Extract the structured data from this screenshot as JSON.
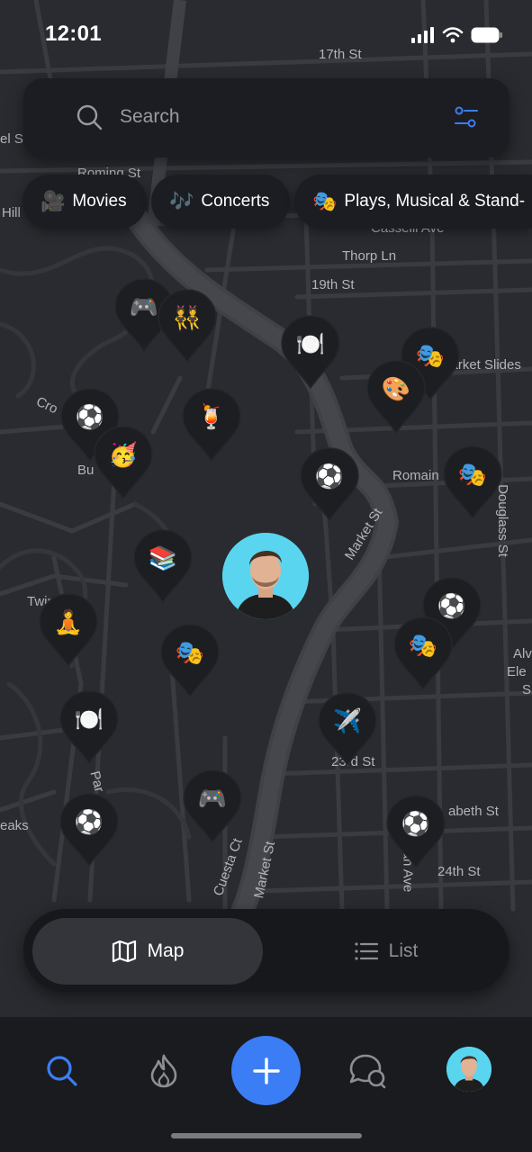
{
  "status": {
    "time": "12:01"
  },
  "search": {
    "placeholder": "Search"
  },
  "categories": [
    {
      "emoji": "🎥",
      "label": "Movies"
    },
    {
      "emoji": "🎶",
      "label": "Concerts"
    },
    {
      "emoji": "🎭",
      "label": "Plays, Musical & Stand-"
    }
  ],
  "map": {
    "streets": [
      "17th St",
      "Roming St",
      "Casselli Ave",
      "Thorp Ln",
      "19th St",
      "Market Slides",
      "Romain",
      "Market St",
      "23rd St",
      "Market St",
      "Cuesta Ct",
      "24th St",
      "abeth St",
      "Douglass St"
    ],
    "edge_labels": [
      "el St",
      "Hill",
      "Cro",
      "Bu",
      "Twin",
      "Alv",
      "Ele",
      "S",
      "eaks",
      "Par",
      "an Ave"
    ],
    "pins": [
      {
        "emoji": "🎮",
        "name": "gaming"
      },
      {
        "emoji": "👯",
        "name": "friends"
      },
      {
        "emoji": "🍽️",
        "name": "dining"
      },
      {
        "emoji": "🎭",
        "name": "theater"
      },
      {
        "emoji": "🎨",
        "name": "art"
      },
      {
        "emoji": "⚽",
        "name": "soccer"
      },
      {
        "emoji": "🍹",
        "name": "cocktail"
      },
      {
        "emoji": "🥳",
        "name": "party"
      },
      {
        "emoji": "⚽",
        "name": "soccer"
      },
      {
        "emoji": "🎭",
        "name": "theater"
      },
      {
        "emoji": "📚",
        "name": "books"
      },
      {
        "emoji": "⚽",
        "name": "soccer"
      },
      {
        "emoji": "🎭",
        "name": "theater"
      },
      {
        "emoji": "🧘",
        "name": "yoga"
      },
      {
        "emoji": "🎭",
        "name": "theater"
      },
      {
        "emoji": "🍽️",
        "name": "dining"
      },
      {
        "emoji": "✈️",
        "name": "travel"
      },
      {
        "emoji": "🎮",
        "name": "gaming"
      },
      {
        "emoji": "⚽",
        "name": "soccer"
      },
      {
        "emoji": "⚽",
        "name": "soccer"
      }
    ]
  },
  "view_toggle": {
    "map_label": "Map",
    "list_label": "List",
    "selected": "Map"
  },
  "tabbar": {
    "items": [
      "search-icon",
      "flame-icon",
      "plus-icon",
      "chat-icon",
      "profile-avatar"
    ],
    "active": "search-icon"
  },
  "colors": {
    "accent": "#3b7df5",
    "background": "#1c1d21",
    "map": "#2a2b30",
    "avatar_bg": "#5ad5f0"
  }
}
